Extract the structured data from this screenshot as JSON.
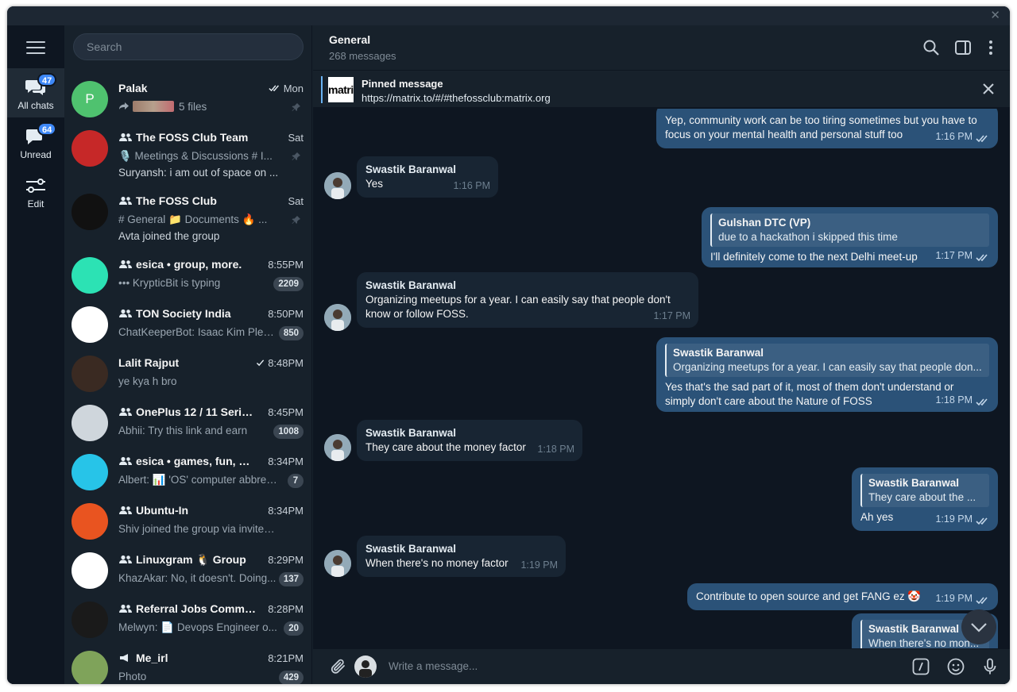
{
  "window": {
    "close_label": "✕"
  },
  "rail": {
    "folders": [
      {
        "label": "All chats",
        "badge": "47"
      },
      {
        "label": "Unread",
        "badge": "64"
      },
      {
        "label": "Edit",
        "badge": ""
      }
    ]
  },
  "search": {
    "placeholder": "Search"
  },
  "chats": [
    {
      "name": "Palak",
      "time": "Mon",
      "sub": "5 files",
      "avatar_letter": "P",
      "avatar_color": "#4fc26f",
      "read": "double",
      "pinned": true
    },
    {
      "name": "The FOSS Club Team",
      "time": "Sat",
      "sub": "🎙️ Meetings & Discussions  # I...",
      "sub2": "Suryansh: i am out of space on ...",
      "avatar_color": "#c62828",
      "pinned": true
    },
    {
      "name": "The FOSS Club",
      "time": "Sat",
      "sub": "# General  📁 Documents  🔥 ...",
      "sub2": "Avta joined the group",
      "avatar_color": "#111111",
      "pinned": true
    },
    {
      "name": "esica • group, more.",
      "time": "8:55PM",
      "sub": "••• KrypticBit is typing",
      "unread": "2209",
      "avatar_color": "#2ce2b4"
    },
    {
      "name": "TON Society India",
      "time": "8:50PM",
      "sub": "ChatKeeperBot: Isaac Kim Plea...",
      "unread": "850",
      "avatar_color": "#ffffff"
    },
    {
      "name": "Lalit Rajput",
      "time": "8:48PM",
      "sub": "ye kya h bro",
      "avatar_color": "#3a2a22",
      "read": "single"
    },
    {
      "name": "OnePlus 12 / 11 Series: ...",
      "time": "8:45PM",
      "sub": "Abhii: Try this link and earn",
      "unread": "1008",
      "avatar_color": "#cfd6dc"
    },
    {
      "name": "esica • games, fun, more.",
      "time": "8:34PM",
      "sub": "Albert: 📊 'OS' computer abbrev...",
      "unread": "7",
      "avatar_color": "#27c4e8"
    },
    {
      "name": "Ubuntu-In",
      "time": "8:34PM",
      "sub": "Shiv joined the group via invite link",
      "avatar_color": "#e95420"
    },
    {
      "name": "Linuxgram 🐧 Group",
      "time": "8:29PM",
      "sub": "KhazAkar: No, it doesn't. Doing...",
      "unread": "137",
      "avatar_color": "#ffffff"
    },
    {
      "name": "Referral Jobs Community",
      "time": "8:28PM",
      "sub": "Melwyn: 📄 Devops Engineer o...",
      "unread": "20",
      "avatar_color": "#1a1a1a"
    },
    {
      "name": "Me_irl",
      "time": "8:21PM",
      "sub": "Photo",
      "unread": "429",
      "avatar_color": "#7fa35a",
      "channel": true
    }
  ],
  "header": {
    "title": "General",
    "subtitle": "268 messages"
  },
  "pinned": {
    "title": "Pinned message",
    "text": "https://matrix.to/#/#thefossclub:matrix.org",
    "logo_text": "matrix"
  },
  "messages": [
    {
      "dir": "out",
      "text": "Yep, community work can be too tiring sometimes but you have to focus on your mental health and personal stuff too",
      "time": "1:16 PM"
    },
    {
      "dir": "in",
      "sender": "Swastik Baranwal",
      "text": "Yes",
      "time": "1:16 PM"
    },
    {
      "dir": "out",
      "reply_name": "Gulshan DTC (VP)",
      "reply_text": "due to a hackathon i skipped this time",
      "text": "I'll definitely come to the next Delhi meet-up",
      "time": "1:17 PM"
    },
    {
      "dir": "in",
      "sender": "Swastik Baranwal",
      "text": "Organizing meetups for a year. I can easily say that people don't know or follow FOSS.",
      "time": "1:17 PM"
    },
    {
      "dir": "out",
      "reply_name": "Swastik Baranwal",
      "reply_text": "Organizing meetups for a year. I can easily say that people don...",
      "text": "Yes that's the sad part of it, most of them don't understand or simply don't care about the Nature of FOSS",
      "time": "1:18 PM"
    },
    {
      "dir": "in",
      "sender": "Swastik Baranwal",
      "text": "They care about the money factor",
      "time": "1:18 PM"
    },
    {
      "dir": "out",
      "reply_name": "Swastik Baranwal",
      "reply_text": "They care about the ...",
      "text": "Ah yes",
      "time": "1:19 PM"
    },
    {
      "dir": "in",
      "sender": "Swastik Baranwal",
      "text": "When there's no money factor",
      "time": "1:19 PM"
    },
    {
      "dir": "out",
      "text": "Contribute to open source and get FANG ez 🤡",
      "time": "1:19 PM"
    },
    {
      "dir": "out",
      "reply_name": "Swastik Baranwal",
      "reply_text": "When there's no mon..."
    }
  ],
  "composer": {
    "placeholder": "Write a message..."
  },
  "colors": {
    "accent": "#3e88f7",
    "outgoing_bubble": "#2b5278",
    "incoming_bubble": "#182533",
    "sidebar": "#17212b",
    "background": "#0e1621"
  },
  "icons": [
    "menu-icon",
    "chats-icon",
    "unread-icon",
    "edit-folders-icon",
    "search-icon",
    "sidebar-toggle-icon",
    "more-icon",
    "close-icon",
    "attach-icon",
    "commands-icon",
    "emoji-icon",
    "microphone-icon",
    "scroll-down-icon",
    "double-check-icon",
    "pin-icon",
    "group-icon",
    "forward-icon",
    "channel-icon"
  ]
}
